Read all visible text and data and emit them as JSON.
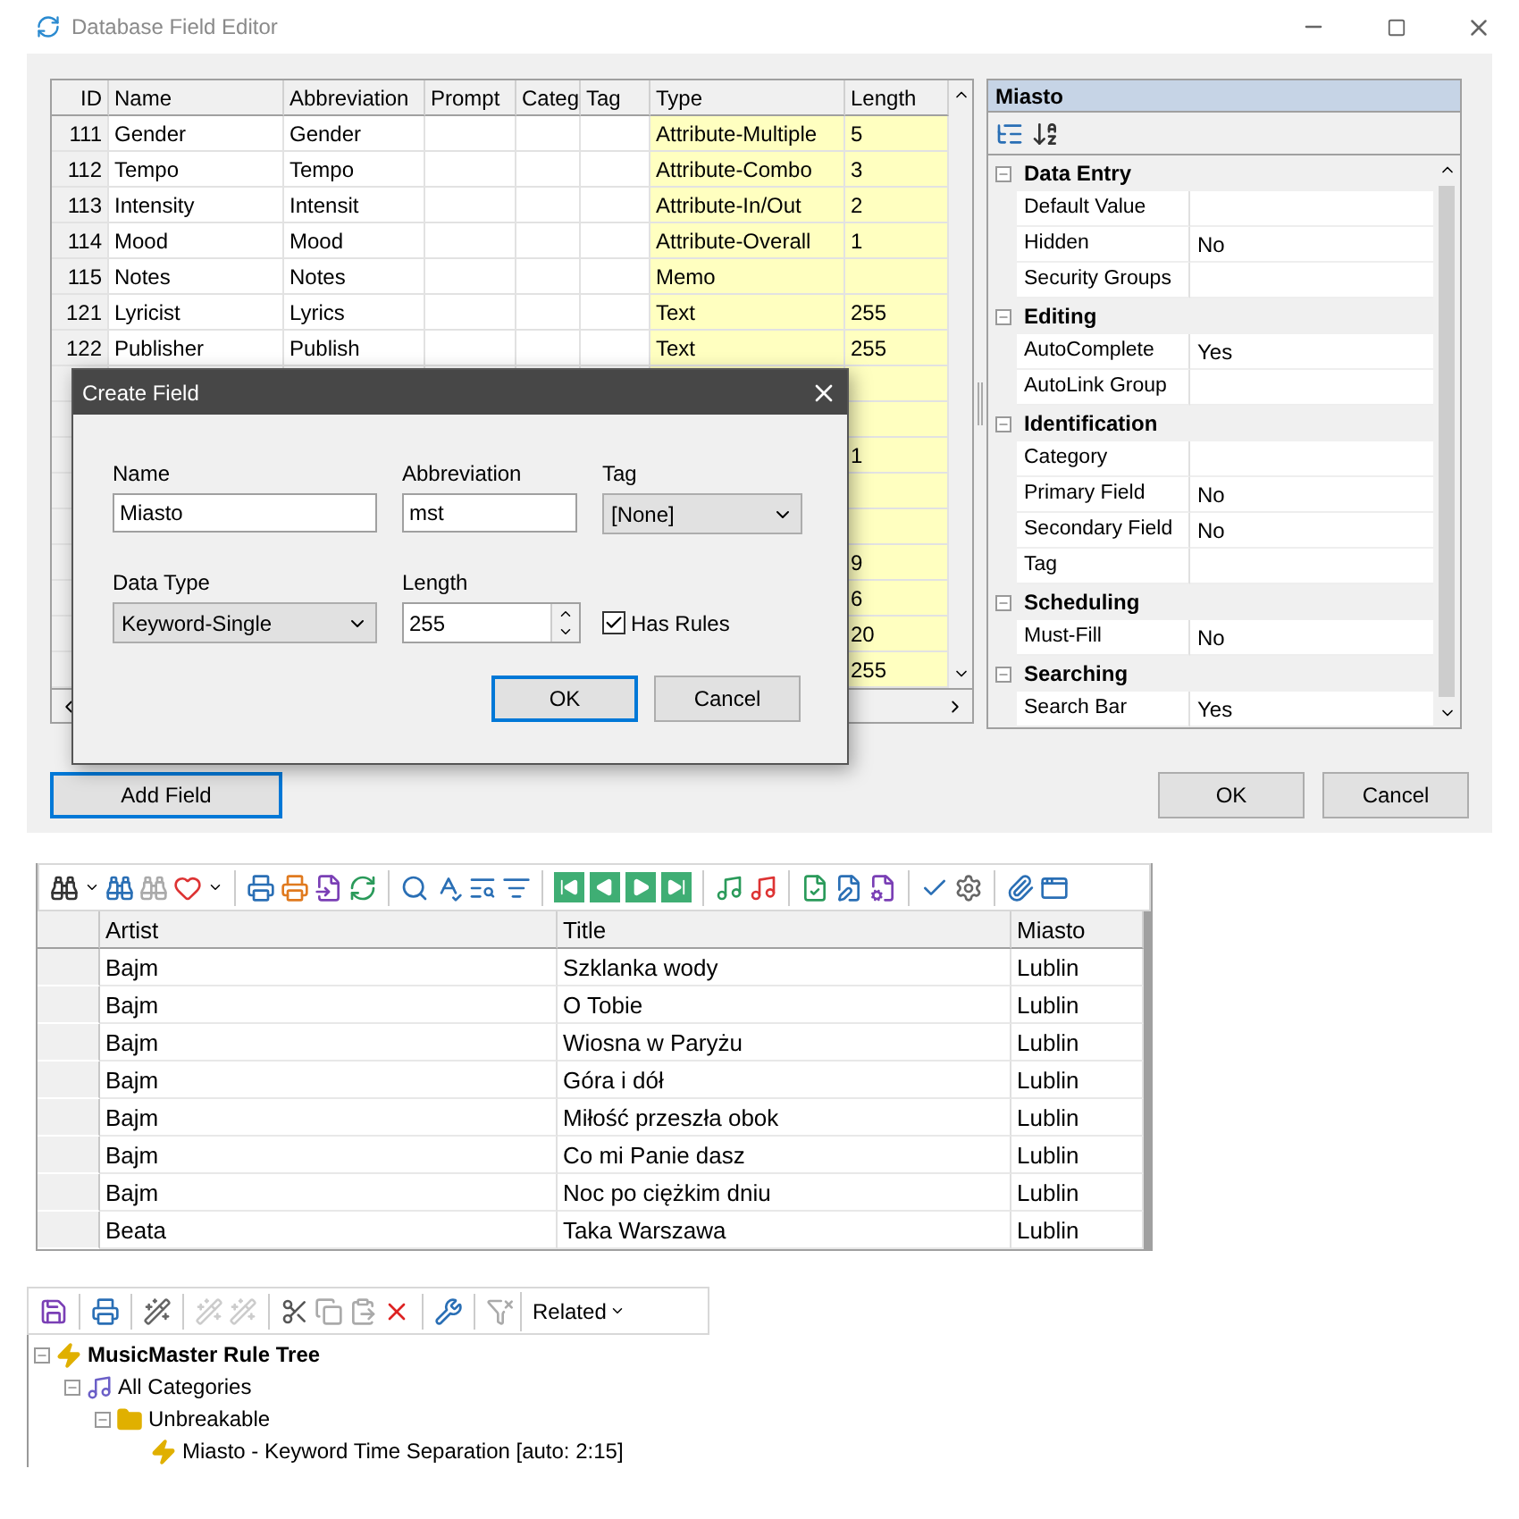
{
  "window": {
    "title": "Database Field Editor"
  },
  "field_table": {
    "columns": [
      "ID",
      "Name",
      "Abbreviation",
      "Prompt",
      "Categ",
      "Tag",
      "Type",
      "Length"
    ],
    "rows": [
      {
        "id": "111",
        "name": "Gender",
        "abbreviation": "Gender",
        "type": "Attribute-Multiple",
        "length": "5"
      },
      {
        "id": "112",
        "name": "Tempo",
        "abbreviation": "Tempo",
        "type": "Attribute-Combo",
        "length": "3"
      },
      {
        "id": "113",
        "name": "Intensity",
        "abbreviation": "Intensit",
        "type": "Attribute-In/Out",
        "length": "2"
      },
      {
        "id": "114",
        "name": "Mood",
        "abbreviation": "Mood",
        "type": "Attribute-Overall",
        "length": "1"
      },
      {
        "id": "115",
        "name": "Notes",
        "abbreviation": "Notes",
        "type": "Memo"
      },
      {
        "id": "121",
        "name": "Lyricist",
        "abbreviation": "Lyrics",
        "type": "Text",
        "length": "255"
      },
      {
        "id": "122",
        "name": "Publisher",
        "abbreviation": "Publish",
        "type": "Text",
        "length": "255"
      },
      {},
      {},
      {
        "length": "1"
      },
      {},
      {},
      {
        "length": "9"
      },
      {
        "length": "6"
      },
      {
        "length": "20"
      },
      {
        "length": "255"
      }
    ]
  },
  "properties": {
    "title": "Miasto",
    "categories": [
      {
        "name": "Data Entry",
        "expanded": true,
        "items": [
          {
            "name": "Default Value"
          },
          {
            "name": "Hidden",
            "value": "No"
          },
          {
            "name": "Security Groups"
          }
        ]
      },
      {
        "name": "Editing",
        "expanded": true,
        "items": [
          {
            "name": "AutoComplete",
            "value": "Yes"
          },
          {
            "name": "AutoLink Group"
          }
        ]
      },
      {
        "name": "Identification",
        "expanded": true,
        "items": [
          {
            "name": "Category"
          },
          {
            "name": "Primary Field",
            "value": "No"
          },
          {
            "name": "Secondary Field",
            "value": "No"
          },
          {
            "name": "Tag"
          }
        ]
      },
      {
        "name": "Scheduling",
        "expanded": true,
        "items": [
          {
            "name": "Must-Fill",
            "value": "No"
          }
        ]
      },
      {
        "name": "Searching",
        "expanded": true,
        "items": [
          {
            "name": "Search Bar",
            "value": "Yes"
          }
        ]
      }
    ]
  },
  "editor_buttons": {
    "add_field": "Add Field",
    "ok": "OK",
    "cancel": "Cancel"
  },
  "dialog": {
    "title": "Create Field",
    "name": {
      "label": "Name",
      "value": "Miasto"
    },
    "abbreviation": {
      "label": "Abbreviation",
      "value": "mst"
    },
    "tag": {
      "label": "Tag",
      "value": "[None]"
    },
    "data_type": {
      "label": "Data Type",
      "value": "Keyword-Single"
    },
    "length": {
      "label": "Length",
      "value": "255"
    },
    "has_rules": {
      "label": "Has Rules",
      "checked": true
    },
    "ok": "OK",
    "cancel": "Cancel"
  },
  "song_grid": {
    "columns": [
      "Artist",
      "Title",
      "Miasto"
    ],
    "rows": [
      {
        "artist": "Bajm",
        "title": "Szklanka wody",
        "miasto": "Lublin"
      },
      {
        "artist": "Bajm",
        "title": "O Tobie",
        "miasto": "Lublin"
      },
      {
        "artist": "Bajm",
        "title": "Wiosna w Paryżu",
        "miasto": "Lublin"
      },
      {
        "artist": "Bajm",
        "title": "Góra i dół",
        "miasto": "Lublin"
      },
      {
        "artist": "Bajm",
        "title": "Miłość przeszła obok",
        "miasto": "Lublin"
      },
      {
        "artist": "Bajm",
        "title": "Co mi Panie dasz",
        "miasto": "Lublin"
      },
      {
        "artist": "Bajm",
        "title": "Noc po ciężkim dniu",
        "miasto": "Lublin"
      },
      {
        "artist": "Beata",
        "title": "Taka Warszawa",
        "miasto": "Lublin"
      }
    ]
  },
  "rule_toolbar": {
    "related": "Related"
  },
  "rule_tree": [
    {
      "label": "MusicMaster Rule Tree",
      "kind": "root",
      "expanded": true,
      "children": [
        {
          "label": "All Categories",
          "kind": "category",
          "expanded": true,
          "children": [
            {
              "label": "Unbreakable",
              "kind": "group",
              "expanded": true,
              "children": [
                {
                  "label": "Miasto - Keyword Time Separation [auto: 2:15]",
                  "kind": "rule"
                }
              ]
            }
          ]
        }
      ]
    }
  ]
}
